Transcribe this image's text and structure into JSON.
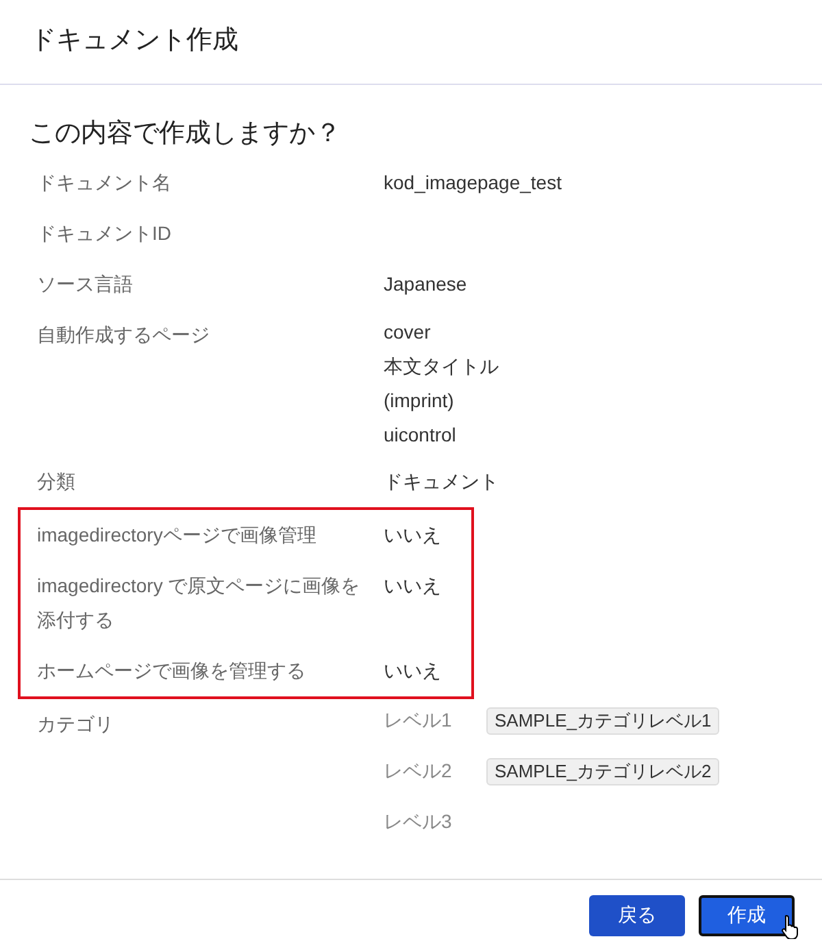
{
  "dialog": {
    "title": "ドキュメント作成"
  },
  "question": "この内容で作成しますか？",
  "sections": [
    {
      "framed": false,
      "rows": [
        {
          "kind": "text",
          "label": "ドキュメント名",
          "value": "kod_imagepage_test"
        },
        {
          "kind": "text",
          "label": "ドキュメントID"
        },
        {
          "kind": "text",
          "label": "ソース言語",
          "value": "Japanese"
        },
        {
          "kind": "list",
          "label": "自動作成するページ",
          "items": [
            "cover",
            "本文タイトル",
            "(imprint)",
            "uicontrol"
          ]
        },
        {
          "kind": "text",
          "label": "分類",
          "value": "ドキュメント"
        }
      ]
    },
    {
      "framed": true,
      "rows": [
        {
          "kind": "text",
          "label": "imagedirectoryページで画像管理",
          "value": "いいえ"
        },
        {
          "kind": "text",
          "label": "imagedirectory で原文ページに画像を添付する",
          "value": "いいえ"
        },
        {
          "kind": "text",
          "label": "ホームページで画像を管理する",
          "value": "いいえ"
        }
      ]
    },
    {
      "framed": false,
      "rows": [
        {
          "kind": "levels",
          "label": "カテゴリ",
          "levels": [
            {
              "name": "レベル1",
              "tag": "SAMPLE_カテゴリレベル1"
            },
            {
              "name": "レベル2",
              "tag": "SAMPLE_カテゴリレベル2"
            },
            {
              "name": "レベル3"
            }
          ]
        }
      ]
    }
  ],
  "buttons": [
    {
      "label": "戻る",
      "focused": false
    },
    {
      "label": "作成",
      "focused": true
    }
  ]
}
